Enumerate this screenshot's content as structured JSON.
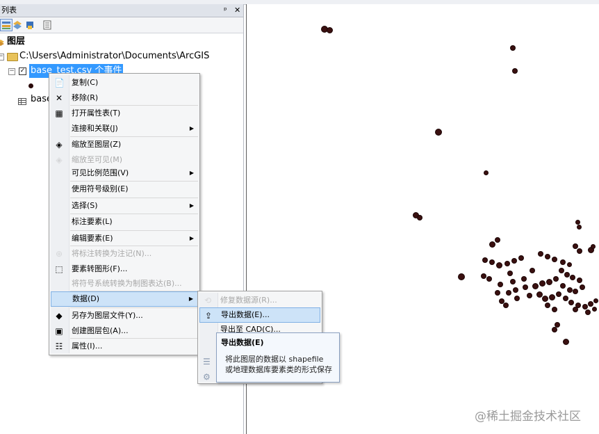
{
  "toc": {
    "title": "列表",
    "pin_glyph": "ᵖ",
    "close_glyph": "✕",
    "layers_root": "图层",
    "folder_path": "C:\\Users\\Administrator\\Documents\\ArcGIS",
    "layer_selected": "base_test.csv 个事件",
    "table_partial": "base"
  },
  "context_menu": {
    "items": [
      {
        "label": "复制(C)",
        "icon": "copy-icon",
        "glyph": "📄",
        "disabled": false,
        "submenu": false
      },
      {
        "label": "移除(R)",
        "icon": "remove-icon",
        "glyph": "✕",
        "disabled": false,
        "submenu": false
      },
      {
        "label": "打开属性表(T)",
        "icon": "table-icon",
        "glyph": "▦",
        "disabled": false,
        "submenu": false
      },
      {
        "label": "连接和关联(J)",
        "icon": "",
        "glyph": "",
        "disabled": false,
        "submenu": true
      },
      {
        "label": "缩放至图层(Z)",
        "icon": "zoom-layer-icon",
        "glyph": "◈",
        "disabled": false,
        "submenu": false
      },
      {
        "label": "缩放至可见(M)",
        "icon": "zoom-visible-icon",
        "glyph": "◈",
        "disabled": true,
        "submenu": false
      },
      {
        "label": "可见比例范围(V)",
        "icon": "",
        "glyph": "",
        "disabled": false,
        "submenu": true
      },
      {
        "label": "使用符号级别(E)",
        "icon": "",
        "glyph": "",
        "disabled": false,
        "submenu": false
      },
      {
        "label": "选择(S)",
        "icon": "",
        "glyph": "",
        "disabled": false,
        "submenu": true
      },
      {
        "label": "标注要素(L)",
        "icon": "",
        "glyph": "",
        "disabled": false,
        "submenu": false
      },
      {
        "label": "编辑要素(E)",
        "icon": "",
        "glyph": "",
        "disabled": false,
        "submenu": true
      },
      {
        "label": "将标注转换为注记(N)...",
        "icon": "convert-labels-icon",
        "glyph": "⊕",
        "disabled": true,
        "submenu": false
      },
      {
        "label": "要素转图形(F)...",
        "icon": "features-to-graphics-icon",
        "glyph": "⬚",
        "disabled": false,
        "submenu": false
      },
      {
        "label": "将符号系统转换为制图表达(B)...",
        "icon": "",
        "glyph": "",
        "disabled": true,
        "submenu": false
      },
      {
        "label": "数据(D)",
        "icon": "",
        "glyph": "",
        "disabled": false,
        "submenu": true
      },
      {
        "label": "另存为图层文件(Y)...",
        "icon": "save-layer-icon",
        "glyph": "◆",
        "disabled": false,
        "submenu": false
      },
      {
        "label": "创建图层包(A)...",
        "icon": "layer-package-icon",
        "glyph": "▣",
        "disabled": false,
        "submenu": false
      },
      {
        "label": "属性(I)...",
        "icon": "properties-icon",
        "glyph": "☷",
        "disabled": false,
        "submenu": false
      }
    ]
  },
  "data_submenu": {
    "items": [
      {
        "label": "修复数据源(R)...",
        "icon": "repair-source-icon",
        "glyph": "⟲",
        "disabled": true
      },
      {
        "label": "导出数据(E)...",
        "icon": "export-data-icon",
        "glyph": "⇪",
        "disabled": false
      },
      {
        "label": "导出至 CAD(C)...",
        "icon": "export-cad-icon",
        "glyph": "",
        "disabled": false
      }
    ]
  },
  "tooltip": {
    "title": "导出数据(E)",
    "line1": "将此图层的数据以 shapefile",
    "line2": "或地理数据库要素类的形式保存"
  },
  "watermark": "@稀土掘金技术社区"
}
